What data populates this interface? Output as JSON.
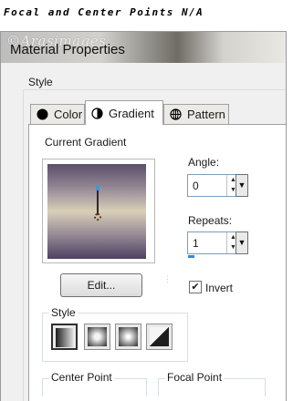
{
  "caption": "Focal and Center Points N/A",
  "watermark": "©Arasimages",
  "window": {
    "title": "Material Properties"
  },
  "section_label": "Style",
  "tabs": [
    {
      "label": "Color",
      "icon": "filled-circle-icon"
    },
    {
      "label": "Gradient",
      "icon": "half-circle-icon",
      "active": true
    },
    {
      "label": "Pattern",
      "icon": "globe-pattern-icon"
    }
  ],
  "gradient": {
    "current_label": "Current Gradient",
    "colors": [
      "#5a4f6a",
      "#8d8090",
      "#d9cfb8",
      "#4c4160"
    ],
    "angle_label": "Angle:",
    "angle_value": "0",
    "repeats_label": "Repeats:",
    "repeats_value": "1",
    "edit_label": "Edit...",
    "invert_label": "Invert",
    "invert_checked": true
  },
  "style_group": {
    "label": "Style",
    "options": [
      "linear-gradient-icon",
      "rectangular-gradient-icon",
      "sunburst-gradient-icon",
      "radial-gradient-icon"
    ],
    "selected_index": 0
  },
  "center_point_label": "Center Point",
  "focal_point_label": "Focal Point"
}
